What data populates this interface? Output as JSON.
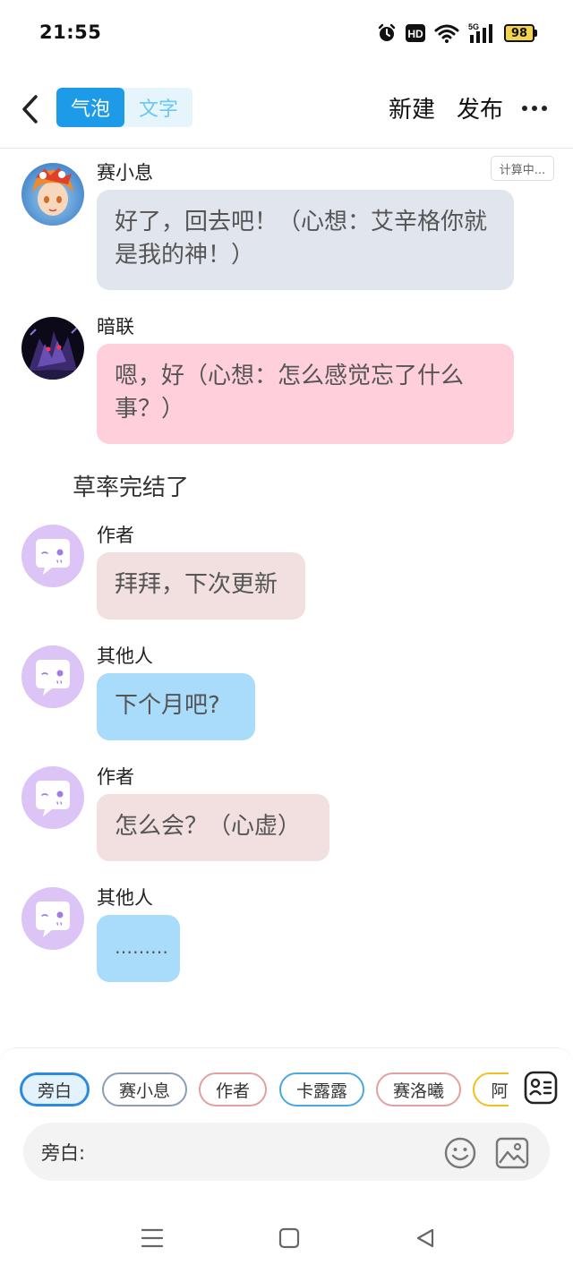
{
  "status_bar": {
    "time": "21:55",
    "battery": "98",
    "network": "5G",
    "hd_badge": "HD"
  },
  "header": {
    "mode_tabs": [
      "气泡",
      "文字"
    ],
    "active_mode": "气泡",
    "new_label": "新建",
    "publish_label": "发布"
  },
  "status_chip": "计算中...",
  "messages": [
    {
      "sender": "赛小息",
      "text": "好了，回去吧！（心想：艾辛格你就是我的神！）",
      "bubble_color": "#e1e6ee"
    },
    {
      "sender": "暗联",
      "text": "嗯，好（心想：怎么感觉忘了什么事？）",
      "bubble_color": "#ffd0db"
    },
    {
      "narration": "草率完结了"
    },
    {
      "sender": "作者",
      "text": "拜拜，下次更新",
      "bubble_color": "#f2dfdf"
    },
    {
      "sender": "其他人",
      "text": "下个月吧?",
      "bubble_color": "#a8dcfa"
    },
    {
      "sender": "作者",
      "text": "怎么会？（心虚）",
      "bubble_color": "#f2dfdf"
    },
    {
      "sender": "其他人",
      "text": "………",
      "bubble_color": "#a8dcfa"
    }
  ],
  "role_chips": [
    {
      "label": "旁白",
      "selected": true,
      "border": "#2b8be0"
    },
    {
      "label": "赛小息",
      "selected": false,
      "border": "#8c9db8"
    },
    {
      "label": "作者",
      "selected": false,
      "border": "#e3a0a0"
    },
    {
      "label": "卡露露",
      "selected": false,
      "border": "#4aa8de"
    },
    {
      "label": "赛洛曦",
      "selected": false,
      "border": "#e3a0a0"
    },
    {
      "label": "阿",
      "selected": false,
      "border": "#f0c020"
    }
  ],
  "input": {
    "label": "旁白:"
  },
  "colors": {
    "accent": "#1e9be8",
    "default_avatar": "#dcc4f7"
  }
}
